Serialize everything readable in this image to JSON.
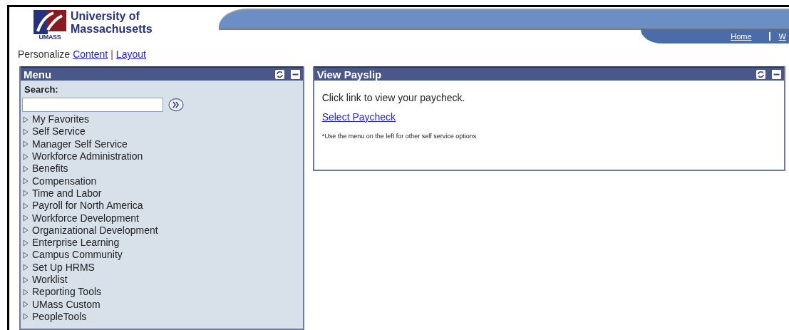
{
  "header": {
    "logo_lines": [
      "University of",
      "Massachusetts"
    ],
    "logo_mark": "UMASS",
    "nav": [
      "Home",
      "W"
    ]
  },
  "personalize": {
    "label": "Personalize",
    "links": [
      "Content",
      "Layout"
    ],
    "separator": "|"
  },
  "menu": {
    "title": "Menu",
    "search_label": "Search:",
    "items": [
      {
        "label": "My Favorites",
        "expanded": false
      },
      {
        "label": "Self Service",
        "expanded": false
      },
      {
        "label": "Manager Self Service",
        "expanded": false
      },
      {
        "label": "Workforce Administration",
        "expanded": false
      },
      {
        "label": "Benefits",
        "expanded": false
      },
      {
        "label": "Compensation",
        "expanded": false
      },
      {
        "label": "Time and Labor",
        "expanded": false
      },
      {
        "label": "Payroll for North America",
        "expanded": false
      },
      {
        "label": "Workforce Development",
        "expanded": false
      },
      {
        "label": "Organizational Development",
        "expanded": false
      },
      {
        "label": "Enterprise Learning",
        "expanded": false
      },
      {
        "label": "Campus Community",
        "expanded": false
      },
      {
        "label": "Set Up HRMS",
        "expanded": false
      },
      {
        "label": "Worklist",
        "expanded": false
      },
      {
        "label": "Reporting Tools",
        "expanded": false
      },
      {
        "label": "UMass Custom",
        "expanded": false
      },
      {
        "label": "PeopleTools",
        "expanded": false
      }
    ]
  },
  "payslip": {
    "title": "View Payslip",
    "intro": "Click link to view your paycheck.",
    "link": "Select Paycheck",
    "note": "*Use the menu on the left for other self service options"
  }
}
